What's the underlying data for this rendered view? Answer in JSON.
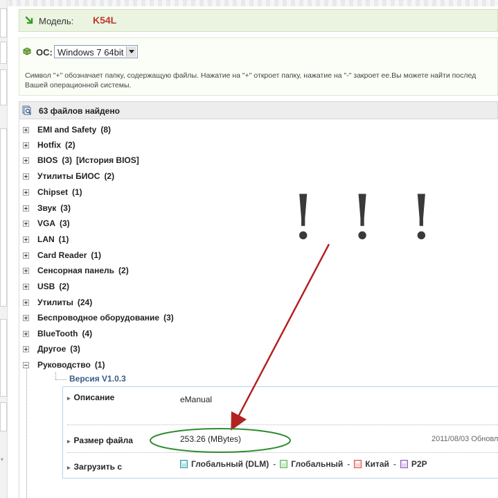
{
  "header": {
    "model_label": "Модель:",
    "model_value": "K54L"
  },
  "os": {
    "label": "ОС:",
    "selected": "Windows 7 64bit",
    "hint_line1": "Символ \"+\" обозначает папку, содержащую файлы. Нажатие на \"+\" откроет папку, нажатие на \"-\" закроет ее.Вы можете найти послед",
    "hint_line2": "Вашей операционной системы."
  },
  "files": {
    "title": "63 файлов найдено",
    "categories": [
      {
        "name": "EMI and Safety",
        "count": "(8)"
      },
      {
        "name": "Hotfix",
        "count": "(2)"
      },
      {
        "name": "BIOS",
        "count": "(3)",
        "extra": "[История BIOS]"
      },
      {
        "name": "Утилиты БИОС",
        "count": "(2)"
      },
      {
        "name": "Chipset",
        "count": "(1)"
      },
      {
        "name": "Звук",
        "count": "(3)"
      },
      {
        "name": "VGA",
        "count": "(3)"
      },
      {
        "name": "LAN",
        "count": "(1)"
      },
      {
        "name": "Card Reader",
        "count": "(1)"
      },
      {
        "name": "Сенсорная панель",
        "count": "(2)"
      },
      {
        "name": "USB",
        "count": "(2)"
      },
      {
        "name": "Утилиты",
        "count": "(24)"
      },
      {
        "name": "Беспроводное оборудование",
        "count": "(3)"
      },
      {
        "name": "BlueTooth",
        "count": "(4)"
      },
      {
        "name": "Другое",
        "count": "(3)"
      },
      {
        "name": "Руководство",
        "count": "(1)"
      }
    ]
  },
  "manual": {
    "version": "Версия V1.0.3",
    "description_label": "Описание",
    "description_value": "eManual",
    "size_label": "Размер файла",
    "size_value": "253.26 (MBytes)",
    "date": "2011/08/03 Обновл",
    "download_label": "Загрузить с",
    "downloads": [
      {
        "label": "Глобальный (DLM)",
        "color": "#3aa0a8"
      },
      {
        "label": "Глобальный",
        "color": "#5cb85c"
      },
      {
        "label": "Китай",
        "color": "#d9534f"
      },
      {
        "label": "P2P",
        "color": "#8e5bb5"
      }
    ],
    "separator": "-"
  },
  "annotation": {
    "text": "! ! !",
    "arrow_color": "#b22222",
    "ellipse_color": "#2e8b2e"
  },
  "colors": {
    "model_red": "#c0392b",
    "version_blue": "#3a5a8a"
  }
}
